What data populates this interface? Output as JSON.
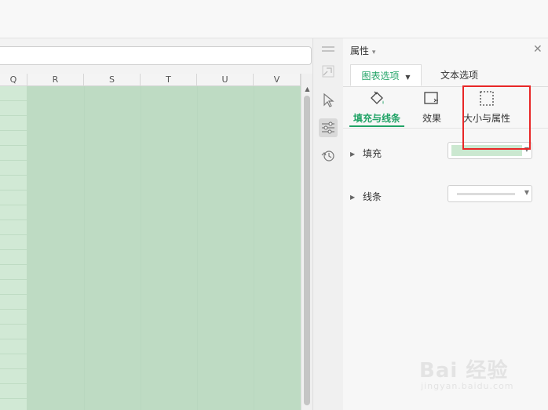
{
  "columns": [
    "Q",
    "R",
    "S",
    "T",
    "U",
    "V"
  ],
  "panel": {
    "title": "属性",
    "title_caret": "▾",
    "close": "✕",
    "tabs": {
      "chart_options": "图表选项",
      "chart_caret": "▼",
      "text_options": "文本选项"
    },
    "subtabs": [
      {
        "label": "填充与线条",
        "icon": "fill-bucket-icon",
        "active": true
      },
      {
        "label": "效果",
        "icon": "effects-icon",
        "active": false
      },
      {
        "label": "大小与属性",
        "icon": "size-properties-icon",
        "active": false
      }
    ],
    "properties": {
      "fill": {
        "label": "填充",
        "expand": "▶"
      },
      "line": {
        "label": "线条",
        "expand": "▶"
      }
    },
    "fill_color": "#cbe8d0",
    "accent_color": "#21a366"
  },
  "toolbar_strip_icons": [
    "menu-icon",
    "link-icon",
    "cursor-icon",
    "settings-sliders-icon",
    "history-icon"
  ],
  "highlight_color": "#e82727",
  "watermark": {
    "main": "Bai 经验",
    "sub": "jingyan.baidu.com"
  }
}
